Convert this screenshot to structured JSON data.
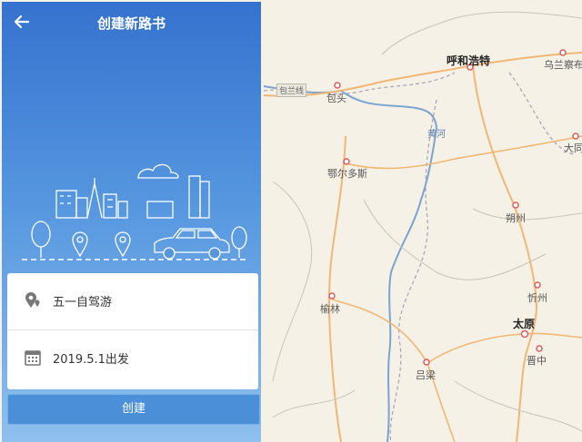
{
  "header": {
    "title": "创建新路书",
    "back_icon": "arrow-left-icon"
  },
  "form": {
    "trip_name": "五一自驾游",
    "trip_name_icon": "map-pin-icon",
    "departure": "2019.5.1出发",
    "departure_icon": "calendar-icon"
  },
  "create_label": "创建",
  "map": {
    "cities": {
      "hohhot": "呼和浩特",
      "ulanqab": "乌兰察布",
      "baotou": "包头",
      "ordos": "鄂尔多斯",
      "datong": "大同",
      "shuozhou": "朔州",
      "xinzhou": "忻州",
      "yulin": "榆林",
      "taiyuan": "太原",
      "jinzhong": "晋中",
      "lvliang": "吕梁"
    },
    "river": "黄河",
    "road": "包兰线"
  },
  "colors": {
    "panel_top": "#3572cf",
    "panel_bottom": "#8fc0ee",
    "accent": "#4a8fd8"
  }
}
